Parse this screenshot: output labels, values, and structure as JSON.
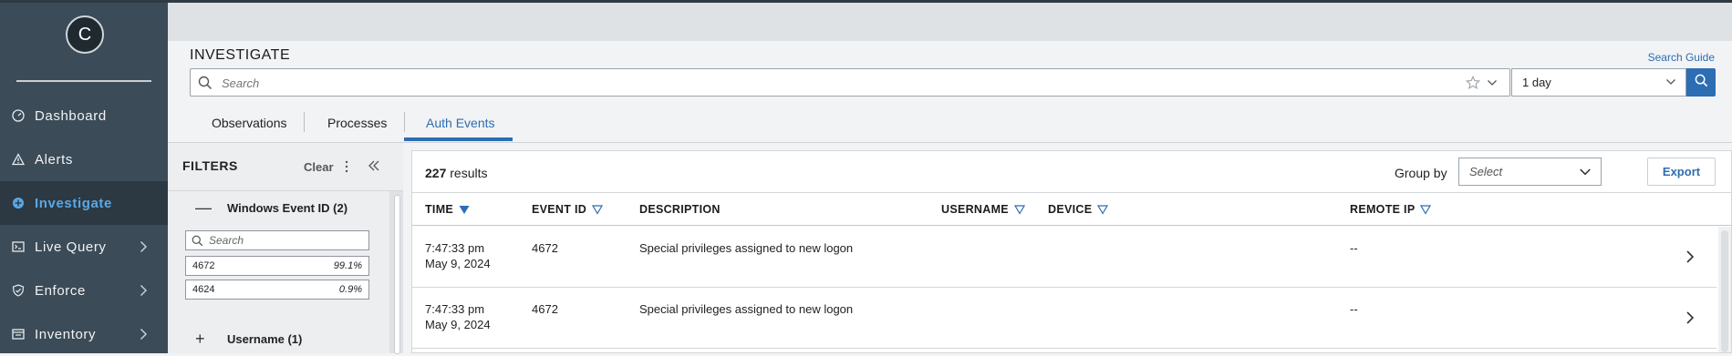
{
  "app": {
    "logo_letter": "C"
  },
  "sidebar": {
    "items": [
      {
        "label": "Dashboard",
        "icon": "gauge-icon",
        "has_submenu": false
      },
      {
        "label": "Alerts",
        "icon": "warning-triangle-icon",
        "has_submenu": false
      },
      {
        "label": "Investigate",
        "icon": "investigate-icon",
        "has_submenu": false,
        "active": true
      },
      {
        "label": "Live Query",
        "icon": "terminal-icon",
        "has_submenu": true
      },
      {
        "label": "Enforce",
        "icon": "shield-check-icon",
        "has_submenu": true
      },
      {
        "label": "Inventory",
        "icon": "inventory-icon",
        "has_submenu": true
      }
    ]
  },
  "header": {
    "title": "INVESTIGATE",
    "search_guide": "Search Guide",
    "search_placeholder": "Search",
    "time_range": "1 day"
  },
  "tabs": [
    {
      "label": "Observations",
      "active": false
    },
    {
      "label": "Processes",
      "active": false
    },
    {
      "label": "Auth Events",
      "active": true
    }
  ],
  "filters": {
    "title": "FILTERS",
    "clear_label": "Clear",
    "groups": [
      {
        "label": "Windows Event ID (2)",
        "expanded": true,
        "toggle": "—",
        "search_placeholder": "Search",
        "values": [
          {
            "key": "4672",
            "percent": "99.1%"
          },
          {
            "key": "4624",
            "percent": "0.9%"
          }
        ]
      },
      {
        "label": "Username (1)",
        "expanded": false,
        "toggle": "+"
      }
    ]
  },
  "results": {
    "count": "227",
    "count_suffix": "results",
    "group_by_label": "Group by",
    "group_by_placeholder": "Select",
    "export_label": "Export",
    "columns": [
      {
        "label": "TIME",
        "sort": "active-desc"
      },
      {
        "label": "EVENT ID",
        "sort": "filter"
      },
      {
        "label": "DESCRIPTION",
        "sort": "none"
      },
      {
        "label": "USERNAME",
        "sort": "filter"
      },
      {
        "label": "DEVICE",
        "sort": "filter"
      },
      {
        "label": "REMOTE IP",
        "sort": "filter"
      }
    ],
    "rows": [
      {
        "time": "7:47:33 pm",
        "date": "May 9, 2024",
        "event_id": "4672",
        "description": "Special privileges assigned to new logon",
        "username": "",
        "device": "",
        "remote_ip": "--"
      },
      {
        "time": "7:47:33 pm",
        "date": "May 9, 2024",
        "event_id": "4672",
        "description": "Special privileges assigned to new logon",
        "username": "",
        "device": "",
        "remote_ip": "--"
      }
    ]
  },
  "colors": {
    "sidebar_bg": "#3b4b57",
    "accent": "#2c6db3",
    "active_nav": "#5aa8e6"
  }
}
